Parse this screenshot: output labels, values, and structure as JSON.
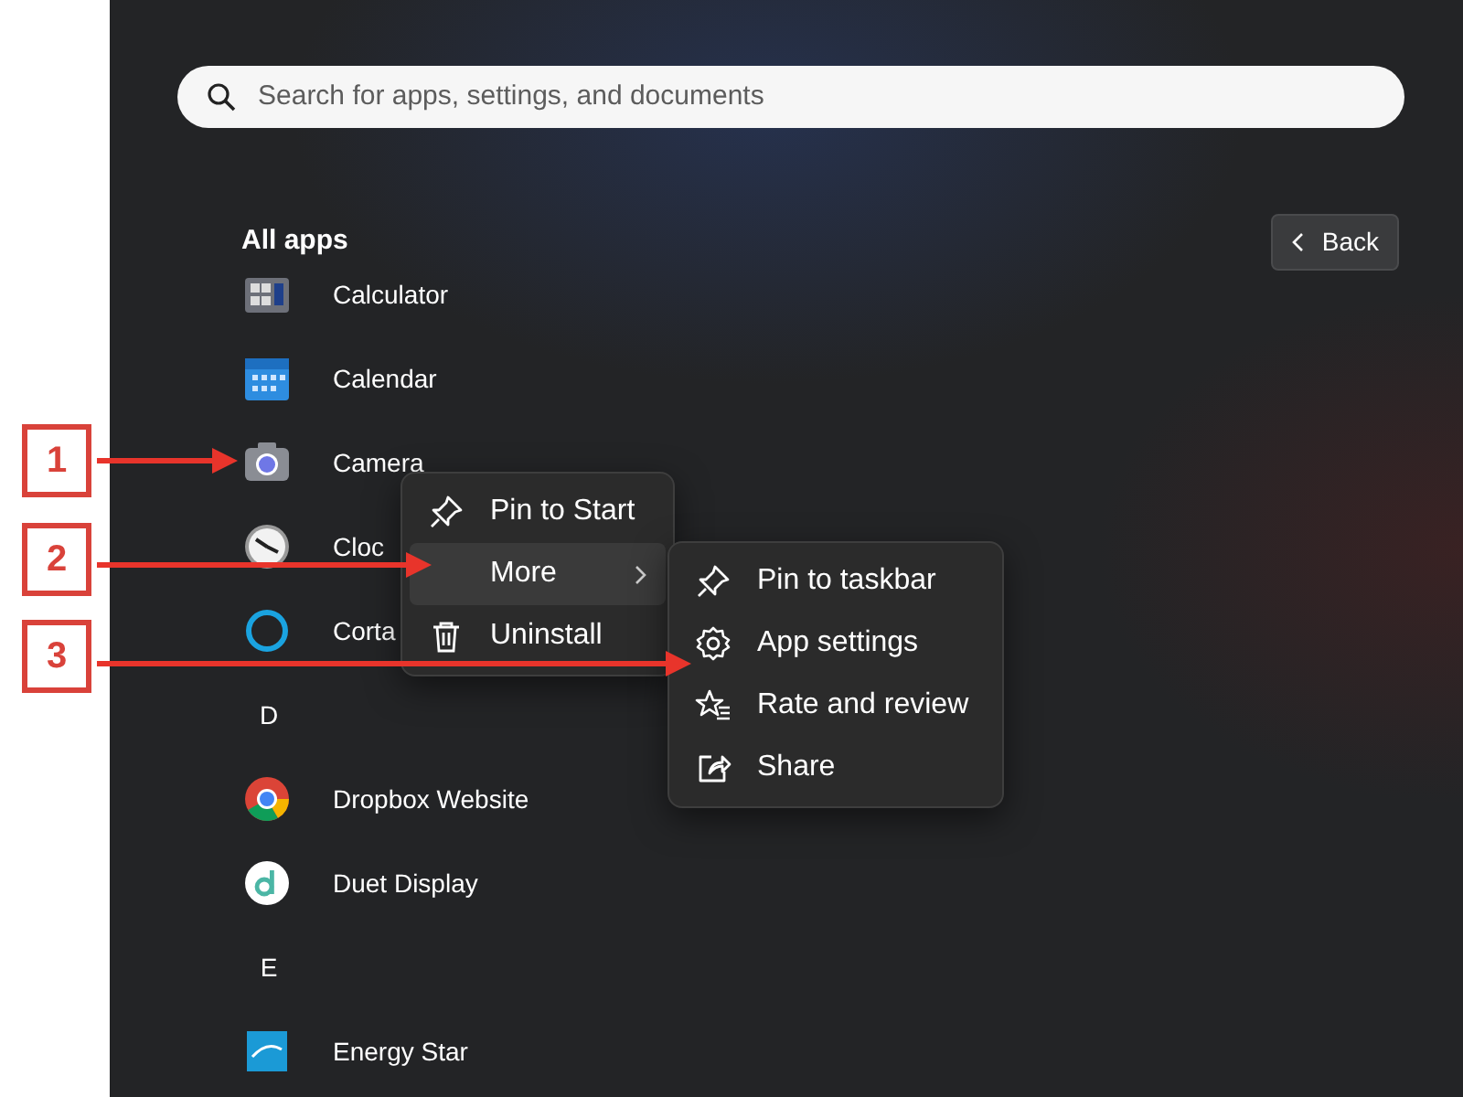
{
  "search": {
    "placeholder": "Search for apps, settings, and documents"
  },
  "all_apps": {
    "title": "All apps",
    "back_button": "Back"
  },
  "apps": [
    {
      "kind": "app",
      "name": "Calculator"
    },
    {
      "kind": "app",
      "name": "Calendar"
    },
    {
      "kind": "app",
      "name": "Camera"
    },
    {
      "kind": "app",
      "name": "Cloc"
    },
    {
      "kind": "app",
      "name": "Corta"
    },
    {
      "kind": "letter",
      "name": "D"
    },
    {
      "kind": "app",
      "name": "Dropbox Website"
    },
    {
      "kind": "app",
      "name": "Duet Display"
    },
    {
      "kind": "letter",
      "name": "E"
    },
    {
      "kind": "app",
      "name": "Energy Star"
    }
  ],
  "context_menu": [
    {
      "label": "Pin to Start",
      "selected": false,
      "kind": "item"
    },
    {
      "label": "More",
      "selected": true,
      "kind": "submenu"
    },
    {
      "label": "Uninstall",
      "selected": false,
      "kind": "item"
    }
  ],
  "submenu": [
    {
      "label": "Pin to taskbar"
    },
    {
      "label": "App settings"
    },
    {
      "label": "Rate and review"
    },
    {
      "label": "Share"
    }
  ],
  "annotations": [
    {
      "label": "1"
    },
    {
      "label": "2"
    },
    {
      "label": "3"
    }
  ]
}
